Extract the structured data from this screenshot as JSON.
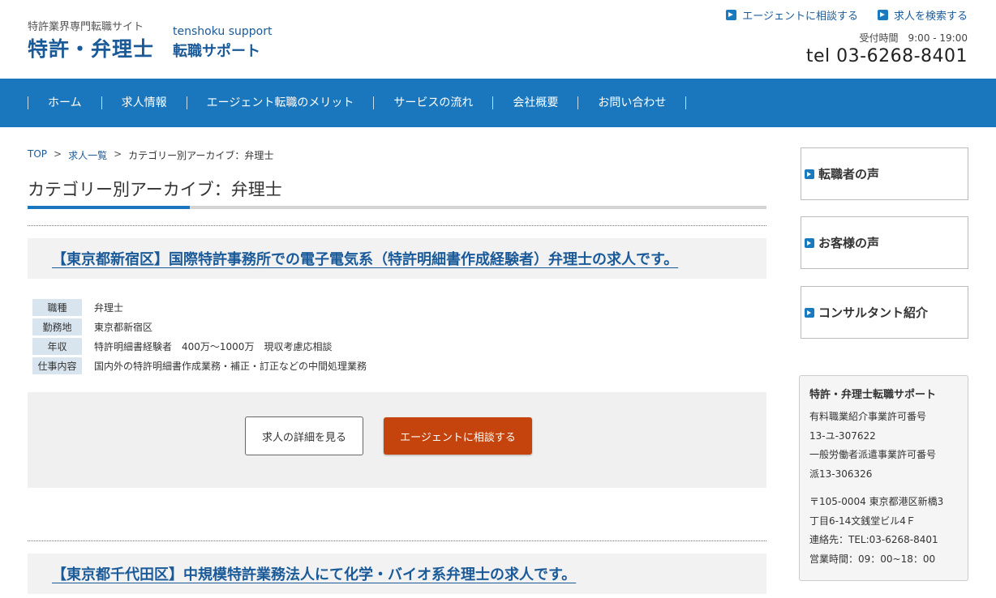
{
  "header": {
    "tagline": "特許業界専門転職サイト",
    "logo_main": "特許・弁理士",
    "logo_sub_en": "tenshoku support",
    "logo_sub_jp": "転職サポート",
    "links": [
      {
        "label": "エージェントに相談する",
        "icon": "arrow-right-icon"
      },
      {
        "label": "求人を検索する",
        "icon": "arrow-right-icon"
      }
    ],
    "hours": "受付時間　9:00 - 19:00",
    "tel": "tel 03-6268-8401"
  },
  "nav": {
    "items": [
      "ホーム",
      "求人情報",
      "エージェント転職のメリット",
      "サービスの流れ",
      "会社概要",
      "お問い合わせ"
    ]
  },
  "breadcrumb": {
    "items": [
      "TOP",
      "求人一覧",
      "カテゴリー別アーカイブ：弁理士"
    ],
    "separator": ">"
  },
  "page": {
    "title": "カテゴリー別アーカイブ：弁理士"
  },
  "jobs": [
    {
      "title": "【東京都新宿区】国際特許事務所での電子電気系（特許明細書作成経験者）弁理士の求人です。",
      "rows": [
        {
          "label": "職種",
          "value": "弁理士"
        },
        {
          "label": "勤務地",
          "value": "東京都新宿区"
        },
        {
          "label": "年収",
          "value": "特許明細書経験者　400万～1000万　現収考慮応相談"
        },
        {
          "label": "仕事内容",
          "value": "国内外の特許明細書作成業務・補正・訂正などの中間処理業務"
        }
      ],
      "detail_button": "求人の詳細を見る",
      "agent_button": "エージェントに相談する"
    },
    {
      "title": "【東京都千代田区】中規模特許業務法人にて化学・バイオ系弁理士の求人です。"
    }
  ],
  "sidebar": {
    "boxes": [
      {
        "label": "転職者の声",
        "icon": "arrow-right-icon"
      },
      {
        "label": "お客様の声",
        "icon": "arrow-right-icon"
      },
      {
        "label": "コンサルタント紹介",
        "icon": "arrow-right-icon"
      }
    ],
    "company": {
      "name": "特許・弁理士転職サポート",
      "lines_a": [
        "有料職業紹介事業許可番号",
        "13-ユ-307622",
        "一般労働者派遣事業許可番号",
        "派13-306326"
      ],
      "lines_b": [
        "〒105-0004 東京都港区新橋3",
        "丁目6-14文銭堂ビル4Ｆ",
        "連絡先：TEL:03-6268-8401",
        "営業時間：09：00~18：00"
      ]
    }
  },
  "colors": {
    "nav_bg": "#1a77bd",
    "brand": "#1a5a99",
    "agent_button": "#c5440d",
    "table_label_bg": "#d9e5ee"
  }
}
